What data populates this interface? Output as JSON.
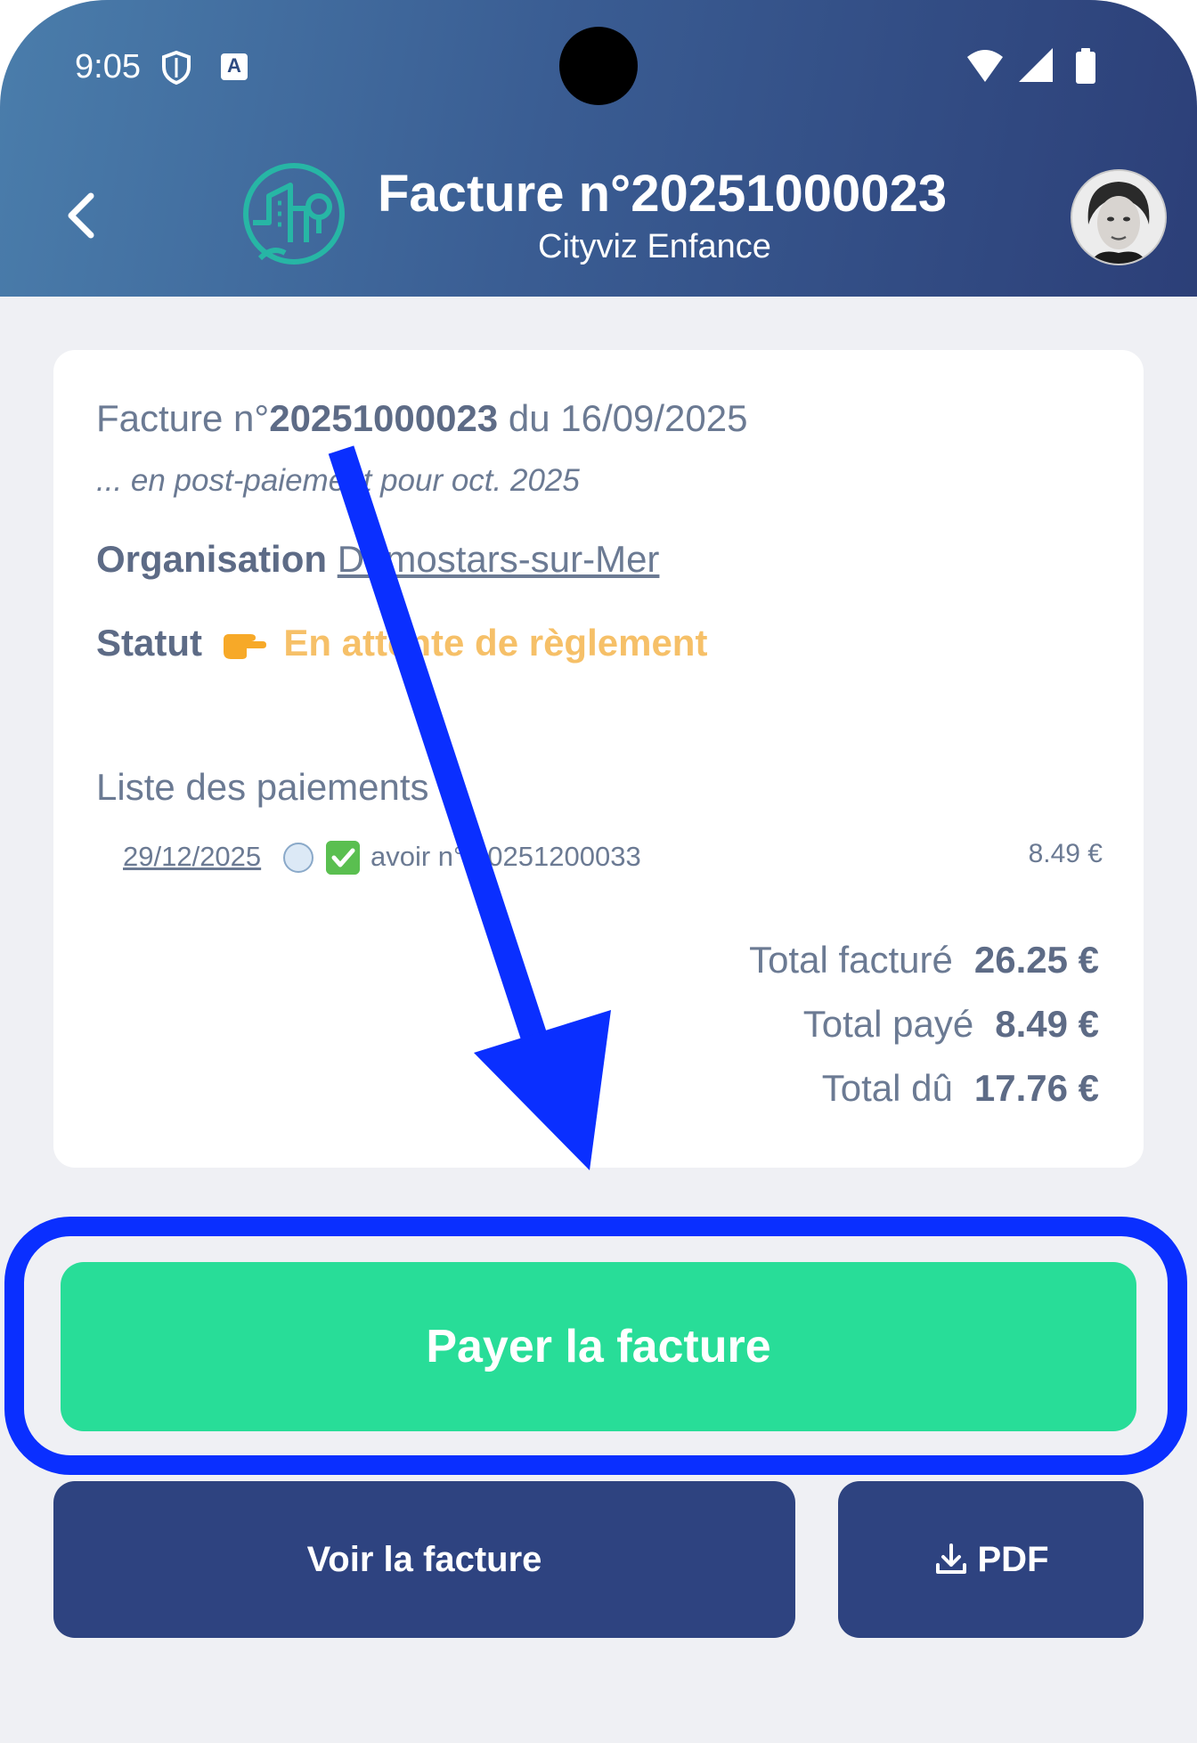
{
  "status_bar": {
    "time": "9:05",
    "icons": [
      "shield-icon",
      "keyboard-a-icon",
      "wifi-icon",
      "signal-icon",
      "battery-icon"
    ]
  },
  "header": {
    "title": "Facture n°20251000023",
    "subtitle": "Cityviz Enfance",
    "logo_icon": "cityviz-logo-icon",
    "back_icon": "chevron-left-icon",
    "avatar_icon": "user-avatar"
  },
  "invoice": {
    "prefix": "Facture n°",
    "number": "20251000023",
    "date_prefix": " du 16/09/2025",
    "note": "... en post-paiement pour oct. 2025",
    "org_label": "Organisation",
    "org_value": "Demostars-sur-Mer",
    "status_label": "Statut",
    "status_value": "En attente de règlement",
    "status_color": "#f6c068"
  },
  "payments": {
    "title": "Liste des paiements",
    "items": [
      {
        "date": "29/12/2025",
        "label": "avoir n° 20251200033",
        "amount": "8.49 €"
      }
    ]
  },
  "totals": {
    "billed_label": "Total facturé",
    "billed_value": "26.25 €",
    "paid_label": "Total payé",
    "paid_value": "8.49 €",
    "due_label": "Total dû",
    "due_value": "17.76 €"
  },
  "actions": {
    "pay_label": "Payer la facture",
    "view_label": "Voir la facture",
    "pdf_label": "PDF",
    "pay_color": "#28dd98",
    "secondary_color": "#2e4380"
  },
  "annotation": {
    "color": "#0a2fff"
  }
}
